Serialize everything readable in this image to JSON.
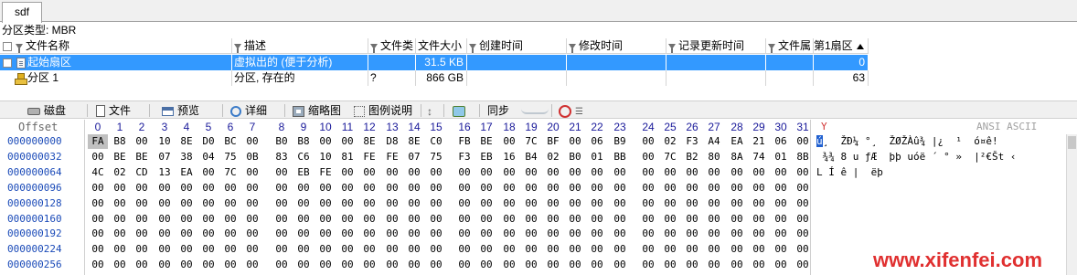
{
  "tab": {
    "label": "sdf"
  },
  "partition_type": "分区类型: MBR",
  "file_table": {
    "headers": {
      "name": "文件名称",
      "desc": "描述",
      "ftype": "文件类",
      "size": "文件大小",
      "created": "创建时间",
      "modified": "修改时间",
      "record": "记录更新时间",
      "attr": "文件属",
      "first_sector": "第1扇区"
    },
    "rows": [
      {
        "name": "起始扇区",
        "desc": "虚拟出的 (便于分析)",
        "ftype": "",
        "size": "31.5 KB",
        "created": "",
        "modified": "",
        "record": "",
        "attr": "",
        "first_sector": "0"
      },
      {
        "name": "分区 1",
        "desc": "分区, 存在的",
        "ftype": "?",
        "size": "866 GB",
        "created": "",
        "modified": "",
        "record": "",
        "attr": "",
        "first_sector": "63"
      }
    ]
  },
  "toolbar": {
    "disk": "磁盘",
    "file": "文件",
    "preview": "预览",
    "detail": "详细",
    "thumbnail": "缩略图",
    "legend": "图例说明",
    "sync": "同步"
  },
  "hex": {
    "offset_label": "Offset",
    "ansi_label": "ANSI ASCII",
    "y_mark": "Y",
    "columns": [
      "0",
      "1",
      "2",
      "3",
      "4",
      "5",
      "6",
      "7",
      "8",
      "9",
      "10",
      "11",
      "12",
      "13",
      "14",
      "15",
      "16",
      "17",
      "18",
      "19",
      "20",
      "21",
      "22",
      "23",
      "24",
      "25",
      "26",
      "27",
      "28",
      "29",
      "30",
      "31"
    ],
    "rows": [
      {
        "offset": "000000000",
        "bytes": [
          "FA",
          "B8",
          "00",
          "10",
          "8E",
          "D0",
          "BC",
          "00",
          "B0",
          "B8",
          "00",
          "00",
          "8E",
          "D8",
          "8E",
          "C0",
          "FB",
          "BE",
          "00",
          "7C",
          "BF",
          "00",
          "06",
          "B9",
          "00",
          "02",
          "F3",
          "A4",
          "EA",
          "21",
          "06",
          "00"
        ],
        "ansi_first": "ú",
        "ansi_rest": "¸  ŽÐ¼ °¸  ŽØŽÀû¾ |¿  ¹  ó¤ê!"
      },
      {
        "offset": "000000032",
        "bytes": [
          "00",
          "BE",
          "BE",
          "07",
          "38",
          "04",
          "75",
          "0B",
          "83",
          "C6",
          "10",
          "81",
          "FE",
          "FE",
          "07",
          "75",
          "F3",
          "EB",
          "16",
          "B4",
          "02",
          "B0",
          "01",
          "BB",
          "00",
          "7C",
          "B2",
          "80",
          "8A",
          "74",
          "01",
          "8B"
        ],
        "ansi_first": "",
        "ansi_rest": " ¾¾ 8 u ƒÆ  þþ uóë ´ ° »  |²€Št ‹"
      },
      {
        "offset": "000000064",
        "bytes": [
          "4C",
          "02",
          "CD",
          "13",
          "EA",
          "00",
          "7C",
          "00",
          "00",
          "EB",
          "FE",
          "00",
          "00",
          "00",
          "00",
          "00",
          "00",
          "00",
          "00",
          "00",
          "00",
          "00",
          "00",
          "00",
          "00",
          "00",
          "00",
          "00",
          "00",
          "00",
          "00",
          "00"
        ],
        "ansi_first": "",
        "ansi_rest": "L Í ê |  ëþ"
      },
      {
        "offset": "000000096",
        "bytes": [
          "00",
          "00",
          "00",
          "00",
          "00",
          "00",
          "00",
          "00",
          "00",
          "00",
          "00",
          "00",
          "00",
          "00",
          "00",
          "00",
          "00",
          "00",
          "00",
          "00",
          "00",
          "00",
          "00",
          "00",
          "00",
          "00",
          "00",
          "00",
          "00",
          "00",
          "00",
          "00"
        ],
        "ansi_first": "",
        "ansi_rest": ""
      },
      {
        "offset": "000000128",
        "bytes": [
          "00",
          "00",
          "00",
          "00",
          "00",
          "00",
          "00",
          "00",
          "00",
          "00",
          "00",
          "00",
          "00",
          "00",
          "00",
          "00",
          "00",
          "00",
          "00",
          "00",
          "00",
          "00",
          "00",
          "00",
          "00",
          "00",
          "00",
          "00",
          "00",
          "00",
          "00",
          "00"
        ],
        "ansi_first": "",
        "ansi_rest": ""
      },
      {
        "offset": "000000160",
        "bytes": [
          "00",
          "00",
          "00",
          "00",
          "00",
          "00",
          "00",
          "00",
          "00",
          "00",
          "00",
          "00",
          "00",
          "00",
          "00",
          "00",
          "00",
          "00",
          "00",
          "00",
          "00",
          "00",
          "00",
          "00",
          "00",
          "00",
          "00",
          "00",
          "00",
          "00",
          "00",
          "00"
        ],
        "ansi_first": "",
        "ansi_rest": ""
      },
      {
        "offset": "000000192",
        "bytes": [
          "00",
          "00",
          "00",
          "00",
          "00",
          "00",
          "00",
          "00",
          "00",
          "00",
          "00",
          "00",
          "00",
          "00",
          "00",
          "00",
          "00",
          "00",
          "00",
          "00",
          "00",
          "00",
          "00",
          "00",
          "00",
          "00",
          "00",
          "00",
          "00",
          "00",
          "00",
          "00"
        ],
        "ansi_first": "",
        "ansi_rest": ""
      },
      {
        "offset": "000000224",
        "bytes": [
          "00",
          "00",
          "00",
          "00",
          "00",
          "00",
          "00",
          "00",
          "00",
          "00",
          "00",
          "00",
          "00",
          "00",
          "00",
          "00",
          "00",
          "00",
          "00",
          "00",
          "00",
          "00",
          "00",
          "00",
          "00",
          "00",
          "00",
          "00",
          "00",
          "00",
          "00",
          "00"
        ],
        "ansi_first": "",
        "ansi_rest": ""
      },
      {
        "offset": "000000256",
        "bytes": [
          "00",
          "00",
          "00",
          "00",
          "00",
          "00",
          "00",
          "00",
          "00",
          "00",
          "00",
          "00",
          "00",
          "00",
          "00",
          "00",
          "00",
          "00",
          "00",
          "00",
          "00",
          "00",
          "00",
          "00",
          "00",
          "00",
          "00",
          "00",
          "00",
          "00",
          "00",
          "00"
        ],
        "ansi_first": "",
        "ansi_rest": ""
      }
    ]
  },
  "watermark": "www.xifenfei.com",
  "colors": {
    "selection": "#3399ff",
    "offset": "#1a4ab8",
    "accent_red": "#e03030"
  }
}
